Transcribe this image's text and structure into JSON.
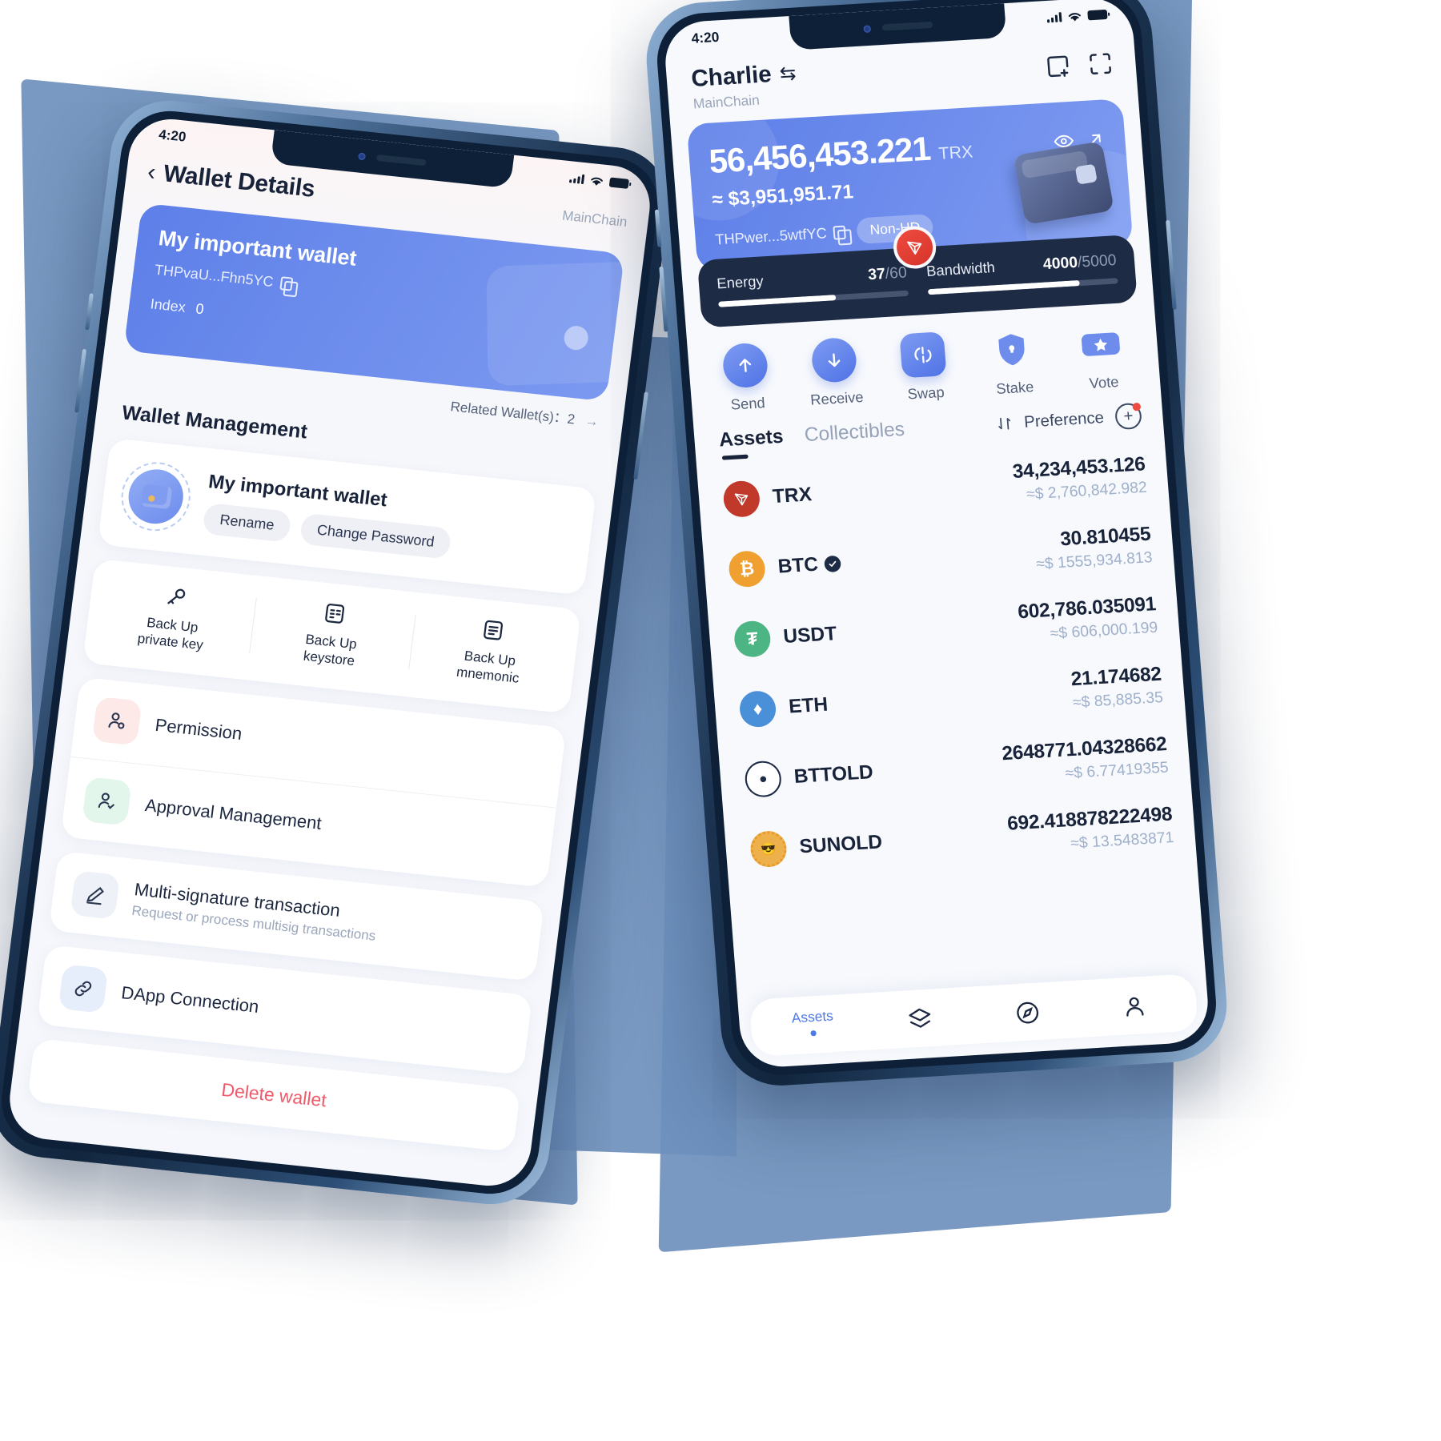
{
  "left_phone": {
    "status": {
      "time": "4:20",
      "signal_icon": "signal-bars-icon",
      "wifi_icon": "wifi-icon",
      "battery_icon": "battery-icon"
    },
    "nav": {
      "back_icon": "chevron-left-icon",
      "title": "Wallet Details",
      "chain": "MainChain"
    },
    "wallet_card": {
      "name": "My important wallet",
      "address": "THPvaU...Fhn5YC",
      "copy_icon": "copy-icon",
      "index_label": "Index",
      "index_value": "0"
    },
    "related": {
      "label": "Related Wallet(s)：2",
      "arrow_icon": "arrow-right-icon"
    },
    "section_title": "Wallet Management",
    "wallet_manage": {
      "avatar_icon": "wallet-avatar-icon",
      "name": "My important wallet",
      "rename_label": "Rename",
      "change_password_label": "Change Password"
    },
    "backups": [
      {
        "icon": "key-icon",
        "line1": "Back Up",
        "line2": "private key"
      },
      {
        "icon": "keystore-document-icon",
        "line1": "Back Up",
        "line2": "keystore"
      },
      {
        "icon": "mnemonic-document-icon",
        "line1": "Back Up",
        "line2": "mnemonic"
      }
    ],
    "menu": [
      {
        "icon": "user-permission-icon",
        "title": "Permission",
        "sub": "",
        "bg": "#fde9e8"
      },
      {
        "icon": "user-check-icon",
        "title": "Approval Management",
        "sub": "",
        "bg": "#e2f6ec"
      },
      {
        "icon": "pencil-icon",
        "title": "Multi-signature transaction",
        "sub": "Request or process multisig transactions",
        "bg": "#eef1f7"
      },
      {
        "icon": "link-chain-icon",
        "title": "DApp Connection",
        "sub": "",
        "bg": "#e6eefb"
      }
    ],
    "delete_label": "Delete wallet"
  },
  "right_phone": {
    "status": {
      "time": "4:20",
      "signal_icon": "signal-bars-icon",
      "wifi_icon": "wifi-icon",
      "battery_icon": "battery-icon"
    },
    "header": {
      "account_name": "Charlie",
      "switch_icon": "account-switch-icon",
      "chain": "MainChain",
      "add_account_icon": "add-account-icon",
      "scan_icon": "scan-qr-icon"
    },
    "balance": {
      "amount": "56,456,453.221",
      "unit": "TRX",
      "eye_icon": "eye-icon",
      "expand_icon": "arrow-up-right-icon",
      "usd": "≈ $3,951,951.71",
      "address": "THPwer...5wtfYC",
      "copy_icon": "copy-icon",
      "hd_badge": "Non-HD",
      "wallet_illustration_icon": "wallet-3d-icon",
      "tron_logo_icon": "tron-logo-icon"
    },
    "resources": [
      {
        "label": "Energy",
        "used": "37",
        "total": "60",
        "percent": 62
      },
      {
        "label": "Bandwidth",
        "used": "4000",
        "total": "5000",
        "percent": 80
      }
    ],
    "actions": [
      {
        "icon": "arrow-up-icon",
        "label": "Send"
      },
      {
        "icon": "arrow-down-icon",
        "label": "Receive"
      },
      {
        "icon": "swap-icon",
        "label": "Swap"
      },
      {
        "icon": "shield-lock-icon",
        "label": "Stake"
      },
      {
        "icon": "ticket-star-icon",
        "label": "Vote"
      }
    ],
    "tabs": [
      {
        "label": "Assets",
        "active": true
      },
      {
        "label": "Collectibles",
        "active": false
      }
    ],
    "preference": {
      "sort_icon": "sort-arrows-icon",
      "label": "Preference",
      "add_icon": "add-token-icon"
    },
    "assets": [
      {
        "symbol": "TRX",
        "icon": "tron-coin-icon",
        "color": "#c0392b",
        "verified": false,
        "amount": "34,234,453.126",
        "usd": "≈$ 2,760,842.982"
      },
      {
        "symbol": "BTC",
        "icon": "bitcoin-coin-icon",
        "color": "#f0a030",
        "verified": true,
        "amount": "30.810455",
        "usd": "≈$ 1555,934.813"
      },
      {
        "symbol": "USDT",
        "icon": "tether-coin-icon",
        "color": "#4cb583",
        "verified": false,
        "amount": "602,786.035091",
        "usd": "≈$ 606,000.199"
      },
      {
        "symbol": "ETH",
        "icon": "ethereum-coin-icon",
        "color": "#4a90d9",
        "verified": false,
        "amount": "21.174682",
        "usd": "≈$ 85,885.35"
      },
      {
        "symbol": "BTTOLD",
        "icon": "bittorrent-coin-icon",
        "color": "#1d2b45",
        "verified": false,
        "amount": "2648771.04328662",
        "usd": "≈$ 6.77419355"
      },
      {
        "symbol": "SUNOLD",
        "icon": "sun-coin-icon",
        "color": "#edb04a",
        "verified": false,
        "amount": "692.418878222498",
        "usd": "≈$ 13.5483871"
      }
    ],
    "bottom_nav": [
      {
        "icon": "assets-icon",
        "label": "Assets",
        "active": true
      },
      {
        "icon": "layers-icon",
        "label": "",
        "active": false
      },
      {
        "icon": "compass-icon",
        "label": "",
        "active": false
      },
      {
        "icon": "profile-icon",
        "label": "",
        "active": false
      }
    ]
  },
  "theme": {
    "accent_blue": "#5d7fe8",
    "dark_navy": "#1d2b45",
    "danger_red": "#ee5b6a",
    "muted_text": "#9aa6bb"
  }
}
